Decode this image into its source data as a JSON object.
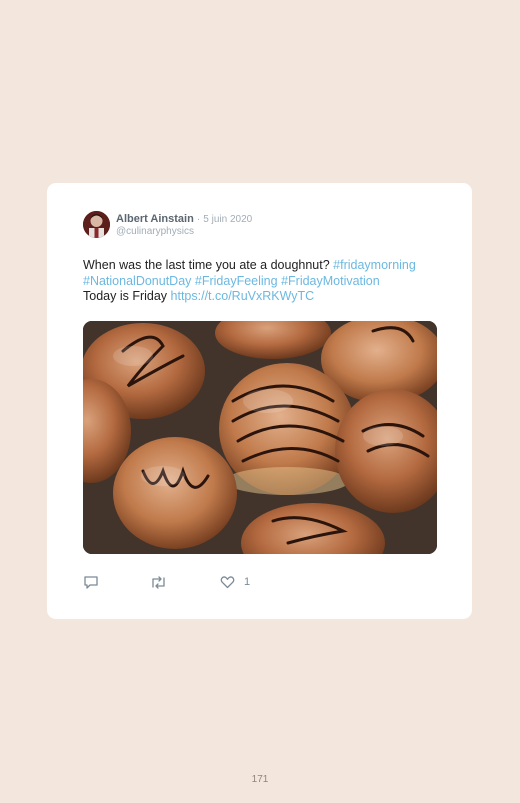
{
  "tweet": {
    "author": {
      "name": "Albert Ainstain",
      "handle": "@culinaryphysics",
      "avatar_icon": "user-avatar"
    },
    "separator": "·",
    "date": "5 juin 2020",
    "text": {
      "line1_prefix": "When was the last time you ate a doughnut? ",
      "hashtag1": "#fridaymorning",
      "hashtag2": "#NationalDonutDay",
      "hashtag3": "#FridayFeeling",
      "hashtag4": "#FridayMotivation",
      "line3_prefix": "Today is Friday ",
      "link": "https://t.co/RuVxRKWyTC"
    },
    "media": {
      "image_icon": "donuts-photo"
    },
    "actions": {
      "reply_icon": "reply-icon",
      "retweet_icon": "retweet-icon",
      "like_icon": "heart-icon",
      "like_count": "1"
    }
  },
  "colors": {
    "page_background": "#f3e7dd",
    "card_background": "#ffffff",
    "link_color": "#6cb8e0",
    "text_color": "#222222",
    "muted_color": "#a3adb5"
  },
  "footer": {
    "page_number": "171"
  }
}
